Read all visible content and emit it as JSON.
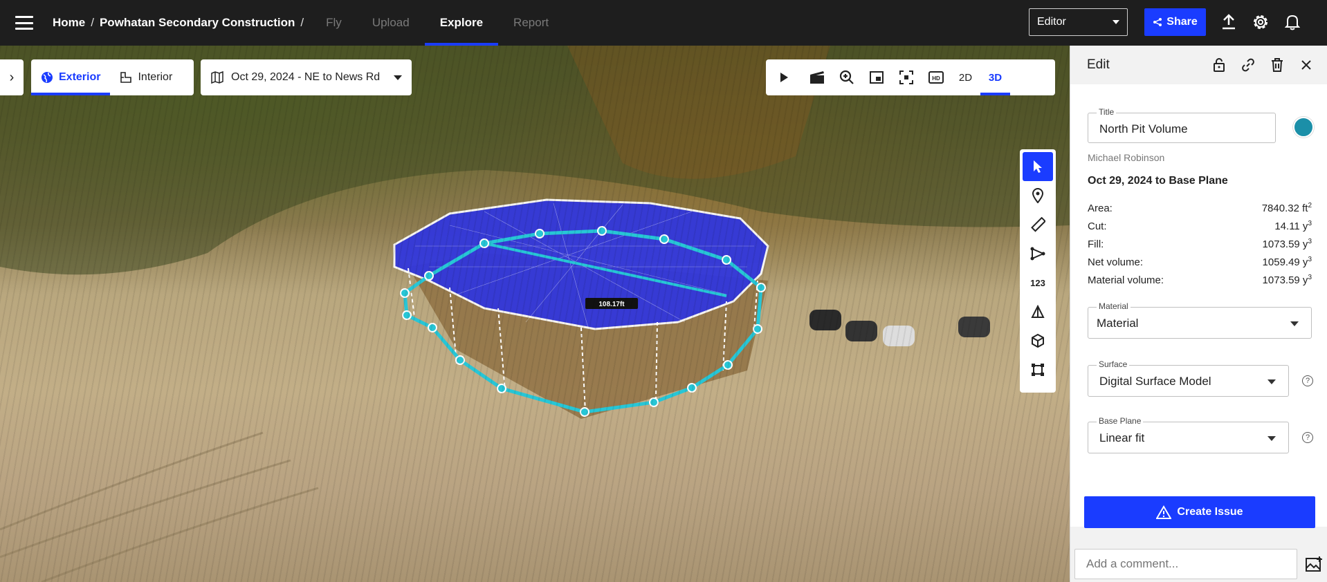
{
  "header": {
    "breadcrumb": {
      "home": "Home",
      "sep1": "/",
      "project": "Powhatan Secondary Construction",
      "sep2": "/"
    },
    "nav_tabs": [
      {
        "label": "Fly"
      },
      {
        "label": "Upload"
      },
      {
        "label": "Explore",
        "active": true
      },
      {
        "label": "Report"
      }
    ],
    "role_select": "Editor",
    "share_label": "Share",
    "icons": [
      "menu-icon",
      "upload-icon",
      "gear-icon",
      "bell-icon"
    ]
  },
  "map": {
    "mode_tabs": [
      {
        "label": "Exterior",
        "icon": "globe-icon",
        "active": true
      },
      {
        "label": "Interior",
        "icon": "floorplan-icon"
      }
    ],
    "date_select": "Oct 29, 2024 - NE to News Rd",
    "view_tools": {
      "icons": [
        "play-icon",
        "clapperboard-icon",
        "zoom-icon",
        "minimap-icon",
        "fullscreen-icon",
        "hd-icon"
      ],
      "mode_2d": "2D",
      "mode_3d": "3D",
      "active_mode": "3D"
    },
    "draw_tools": {
      "icons": [
        "cursor-icon",
        "pin-icon",
        "ruler-icon",
        "polyline-icon",
        "numbers-icon",
        "cone-icon",
        "cube-icon",
        "crop-icon"
      ],
      "numbers_label": "123",
      "active": "cursor-icon"
    },
    "measure_label": "108.17ft"
  },
  "panel": {
    "title": "Edit",
    "header_icons": [
      "lock-icon",
      "link-icon",
      "trash-icon",
      "close-icon"
    ],
    "title_field": {
      "label": "Title",
      "value": "North Pit Volume"
    },
    "color": "#1b8fa8",
    "author": "Michael Robinson",
    "comparison": "Oct 29, 2024 to Base Plane",
    "metrics": [
      {
        "label": "Area:",
        "value": "7840.32 ft",
        "unit_sup": "2"
      },
      {
        "label": "Cut:",
        "value": "14.11 y",
        "unit_sup": "3"
      },
      {
        "label": "Fill:",
        "value": "1073.59 y",
        "unit_sup": "3"
      },
      {
        "label": "Net volume:",
        "value": "1059.49 y",
        "unit_sup": "3"
      },
      {
        "label": "Material volume:",
        "value": "1073.59 y",
        "unit_sup": "3"
      }
    ],
    "material": {
      "label": "Material",
      "value": "Material"
    },
    "surface": {
      "label": "Surface",
      "value": "Digital Surface Model"
    },
    "base_plane": {
      "label": "Base Plane",
      "value": "Linear fit"
    },
    "help_glyph": "?",
    "create_issue": "Create Issue",
    "comment_placeholder": "Add a comment..."
  },
  "colors": {
    "accent": "#1a3cff",
    "topbar": "#1e1e1e",
    "volume_fill": "#2f35e0",
    "boundary": "#27c6d6"
  }
}
